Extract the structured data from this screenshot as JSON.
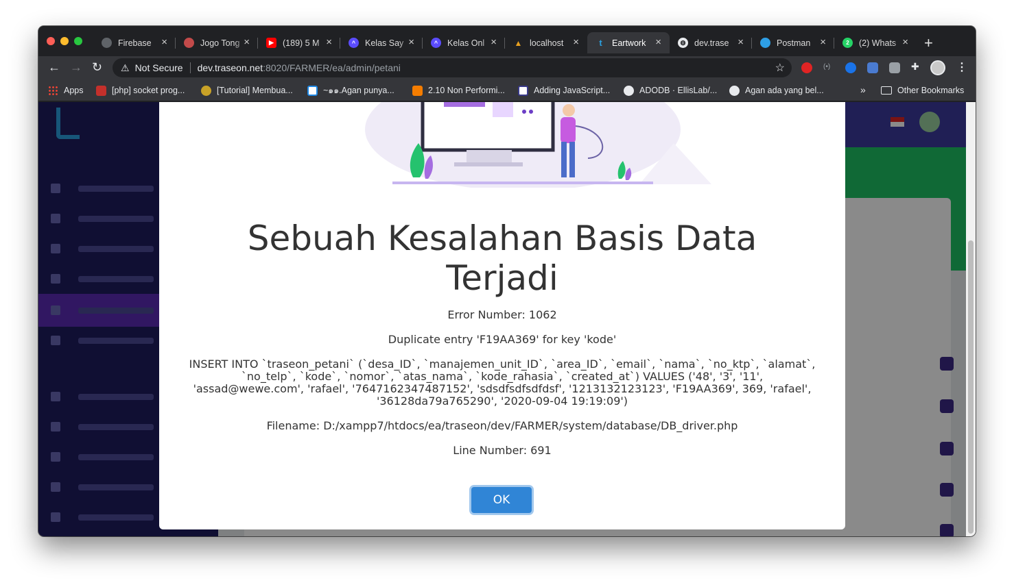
{
  "browser": {
    "tabs": [
      {
        "title": "Firebase",
        "icon": "firebase-icon",
        "color": "#9aa0a6"
      },
      {
        "title": "Jogo Tong",
        "icon": "jogo-tonggo-icon",
        "color": "#e8a0a0"
      },
      {
        "title": "(189) 5 M",
        "icon": "youtube-icon",
        "color": "#ff0000"
      },
      {
        "title": "Kelas Say",
        "icon": "kelas-icon",
        "color": "#5b4cff"
      },
      {
        "title": "Kelas Onl",
        "icon": "kelas-icon",
        "color": "#5b4cff"
      },
      {
        "title": "localhost",
        "icon": "codeigniter-icon",
        "color": "#e8a020"
      },
      {
        "title": "Eartwork",
        "icon": "eartwork-icon",
        "color": "#2b9fe0",
        "active": true
      },
      {
        "title": "dev.trase",
        "icon": "globe-icon",
        "color": "#e8eaed"
      },
      {
        "title": "Postman",
        "icon": "postman-icon",
        "color": "#2e9fe6"
      },
      {
        "title": "(2) Whats",
        "icon": "whatsapp-icon",
        "color": "#25d366"
      }
    ],
    "new_tab_label": "+",
    "address": {
      "security_label": "Not Secure",
      "host": "dev.traseon.net",
      "path": ":8020/FARMER/ea/admin/petani"
    },
    "bookmarks": [
      {
        "label": "Apps",
        "icon": "apps-grid-icon"
      },
      {
        "label": "[php] socket prog...",
        "icon": "bookmark-red-icon"
      },
      {
        "label": "[Tutorial] Membua...",
        "icon": "garuda-icon"
      },
      {
        "label": "~๑๑.Agan punya...",
        "icon": "kaskus-icon"
      },
      {
        "label": "2.10 Non Performi...",
        "icon": "blogger-icon"
      },
      {
        "label": "Adding JavaScript...",
        "icon": "codeigniter-doc-icon"
      },
      {
        "label": "ADODB · EllisLab/...",
        "icon": "github-icon"
      },
      {
        "label": "Agan ada yang bel...",
        "icon": "globe-icon"
      }
    ],
    "more_bookmarks": "»",
    "other_bookmarks": "Other Bookmarks"
  },
  "modal": {
    "title": "Sebuah Kesalahan Basis Data Terjadi",
    "error_number": "Error Number: 1062",
    "message": "Duplicate entry 'F19AA369' for key 'kode'",
    "query": "INSERT INTO `traseon_petani` (`desa_ID`, `manajemen_unit_ID`, `area_ID`, `email`, `nama`, `no_ktp`, `alamat`, `no_telp`, `kode`, `nomor`, `atas_nama`, `kode_rahasia`, `created_at`) VALUES ('48', '3', '11', 'assad@wewe.com', 'rafael', '7647162347487152', 'sdsdfsdfsdfdsf', '1213132123123', 'F19AA369', 369, 'rafael', '36128da79a765290', '2020-09-04 19:19:09')",
    "filename": "Filename: D:/xampp7/htdocs/ea/traseon/dev/FARMER/system/database/DB_driver.php",
    "line_number": "Line Number: 691",
    "ok_label": "OK"
  },
  "colors": {
    "ok_button": "#3085d6",
    "sidebar": "#1f1c5e",
    "header": "#3c3a9e",
    "green_band": "#1ec364"
  }
}
